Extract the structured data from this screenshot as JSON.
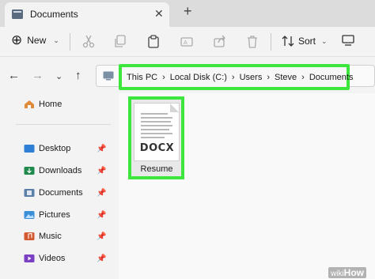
{
  "tab": {
    "title": "Documents",
    "icon": "folder-icon"
  },
  "toolbar": {
    "new_label": "New",
    "sort_label": "Sort",
    "view_label": "View",
    "icons": [
      "scissors-icon",
      "copy-icon",
      "paste-icon",
      "rename-icon",
      "share-icon",
      "trash-icon"
    ]
  },
  "breadcrumb": [
    "This PC",
    "Local Disk (C:)",
    "Users",
    "Steve",
    "Documents"
  ],
  "sidebar": {
    "home": "Home",
    "items": [
      {
        "label": "Desktop",
        "icon": "desktop-icon",
        "color": "#2f7fd6"
      },
      {
        "label": "Downloads",
        "icon": "download-icon",
        "color": "#1f8a4c"
      },
      {
        "label": "Documents",
        "icon": "documents-icon",
        "color": "#5a7fa8"
      },
      {
        "label": "Pictures",
        "icon": "pictures-icon",
        "color": "#3a8fd8"
      },
      {
        "label": "Music",
        "icon": "music-icon",
        "color": "#d35a2e"
      },
      {
        "label": "Videos",
        "icon": "videos-icon",
        "color": "#7a3fc2"
      }
    ]
  },
  "file": {
    "name": "Resume",
    "type_label": "DOCX"
  },
  "watermark": {
    "brand": "wiki",
    "suffix": "How"
  },
  "colors": {
    "highlight": "#3ce63c"
  }
}
